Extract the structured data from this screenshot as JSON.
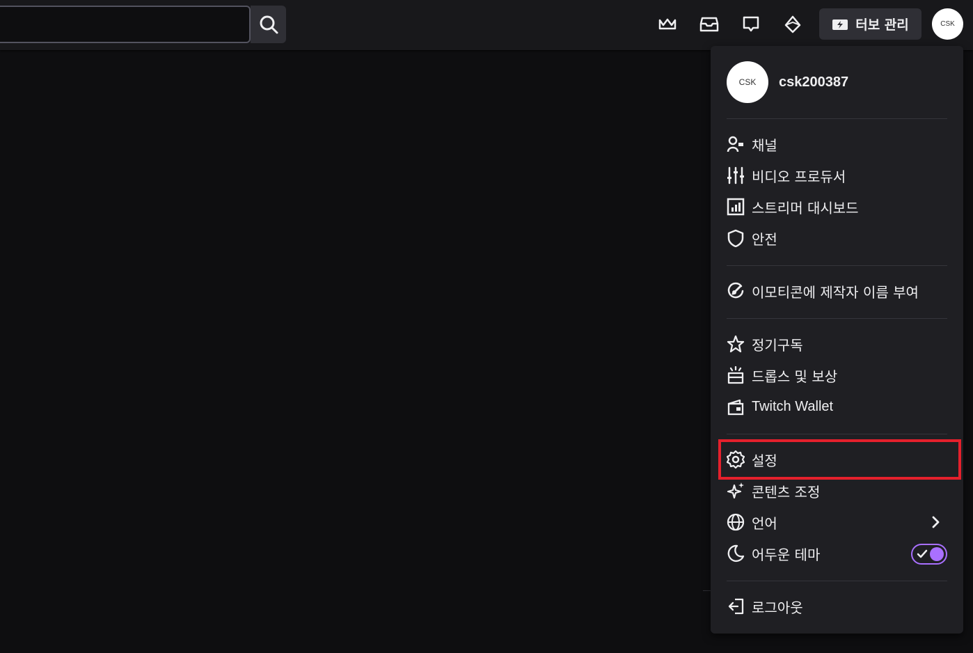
{
  "topbar": {
    "search_value": "",
    "icons": [
      "crown-icon",
      "inbox-icon",
      "whispers-icon",
      "bits-icon"
    ],
    "turbo_label": "터보 관리",
    "avatar_text": "CSK"
  },
  "menu": {
    "avatar_text": "CSK",
    "username": "csk200387",
    "groups": [
      [
        {
          "label": "채널",
          "icon": "channel-icon"
        },
        {
          "label": "비디오 프로듀서",
          "icon": "video-producer-icon"
        },
        {
          "label": "스트리머 대시보드",
          "icon": "dashboard-icon"
        },
        {
          "label": "안전",
          "icon": "shield-icon"
        }
      ],
      [
        {
          "label": "이모티콘에 제작자 이름 부여",
          "icon": "emote-attribution-icon"
        }
      ],
      [
        {
          "label": "정기구독",
          "icon": "star-icon"
        },
        {
          "label": "드롭스 및 보상",
          "icon": "drops-icon"
        },
        {
          "label": "Twitch Wallet",
          "icon": "wallet-icon"
        }
      ],
      [
        {
          "label": "설정",
          "icon": "gear-icon"
        },
        {
          "label": "콘텐츠 조정",
          "icon": "sparkle-icon"
        },
        {
          "label": "언어",
          "icon": "globe-icon"
        },
        {
          "label": "어두운 테마",
          "icon": "moon-icon"
        }
      ],
      [
        {
          "label": "로그아웃",
          "icon": "logout-icon"
        }
      ]
    ],
    "dark_theme_enabled": true
  },
  "colors": {
    "accent": "#a970ff",
    "highlight": "#e4202c",
    "menu_bg": "#1f1f23",
    "topbar_bg": "#18181b",
    "page_bg": "#0e0e10"
  }
}
